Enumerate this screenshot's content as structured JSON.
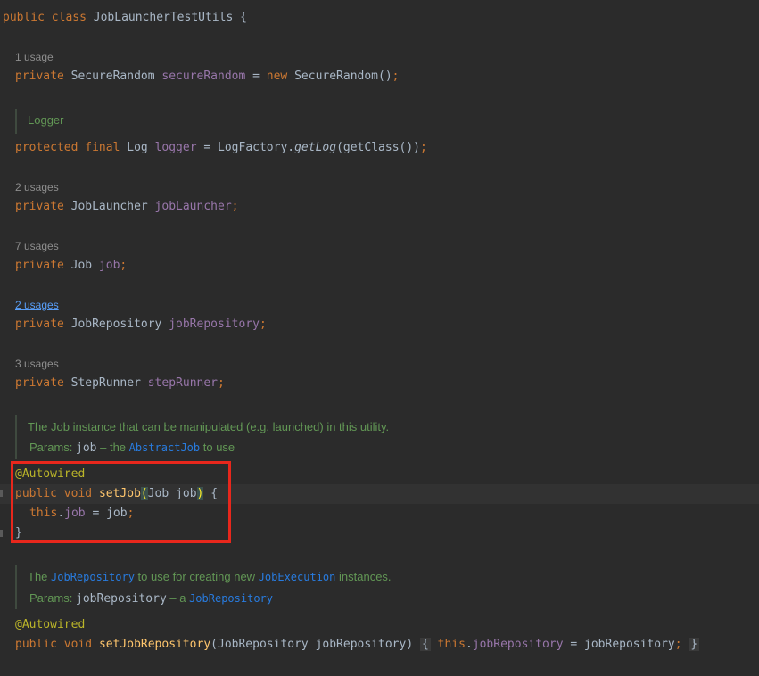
{
  "editor": {
    "class_decl": {
      "kw1": "public",
      "kw2": "class",
      "name": "JobLauncherTestUtils",
      "brace": "{"
    },
    "f1": {
      "usages": "1 usage",
      "kw": "private",
      "type": "SecureRandom",
      "name": "secureRandom",
      "eq": "=",
      "new": "new",
      "init": "SecureRandom()",
      "semi": ";"
    },
    "logger_doc": "Logger",
    "f2": {
      "kw1": "protected",
      "kw2": "final",
      "type": "Log",
      "name": "logger",
      "eq": "=",
      "call_prefix": "LogFactory.",
      "method": "getLog",
      "args": "(getClass())",
      "semi": ";"
    },
    "f3": {
      "usages": "2 usages",
      "kw": "private",
      "type": "JobLauncher",
      "name": "jobLauncher",
      "semi": ";"
    },
    "f4": {
      "usages": "7 usages",
      "kw": "private",
      "type": "Job",
      "name": "job",
      "semi": ";"
    },
    "f5": {
      "usages": "2 usages",
      "kw": "private",
      "type": "JobRepository",
      "name": "jobRepository",
      "semi": ";"
    },
    "f6": {
      "usages": "3 usages",
      "kw": "private",
      "type": "StepRunner",
      "name": "stepRunner",
      "semi": ";"
    },
    "setjob_doc": {
      "text": "The Job instance that can be manipulated (e.g. launched) in this utility.",
      "params_label": "Params:",
      "param": "job",
      "dash": " – the ",
      "ref": "AbstractJob",
      "suffix": " to use"
    },
    "setjob": {
      "annotation": "@Autowired",
      "kw1": "public",
      "kw2": "void",
      "name": "setJob",
      "open_paren": "(",
      "param_decl": "Job job",
      "close_paren": ")",
      "brace": "{",
      "this_kw": "this",
      "dot": ".",
      "field": "job",
      "assign": " = job",
      "semi": ";",
      "close_brace": "}"
    },
    "setrepo_doc": {
      "pre": "The ",
      "ref1": "JobRepository",
      "mid": " to use for creating new ",
      "ref2": "JobExecution",
      "post": " instances.",
      "params_label": "Params:",
      "param": "jobRepository",
      "dash": " – a ",
      "ref3": "JobRepository"
    },
    "setrepo": {
      "annotation": "@Autowired",
      "kw1": "public",
      "kw2": "void",
      "name": "setJobRepository",
      "params": "(JobRepository jobRepository)",
      "open_brace": "{",
      "this_kw": "this",
      "dot": ".",
      "field": "jobRepository",
      "assign": " = jobRepository",
      "semi": ";",
      "close_brace": "}"
    }
  }
}
